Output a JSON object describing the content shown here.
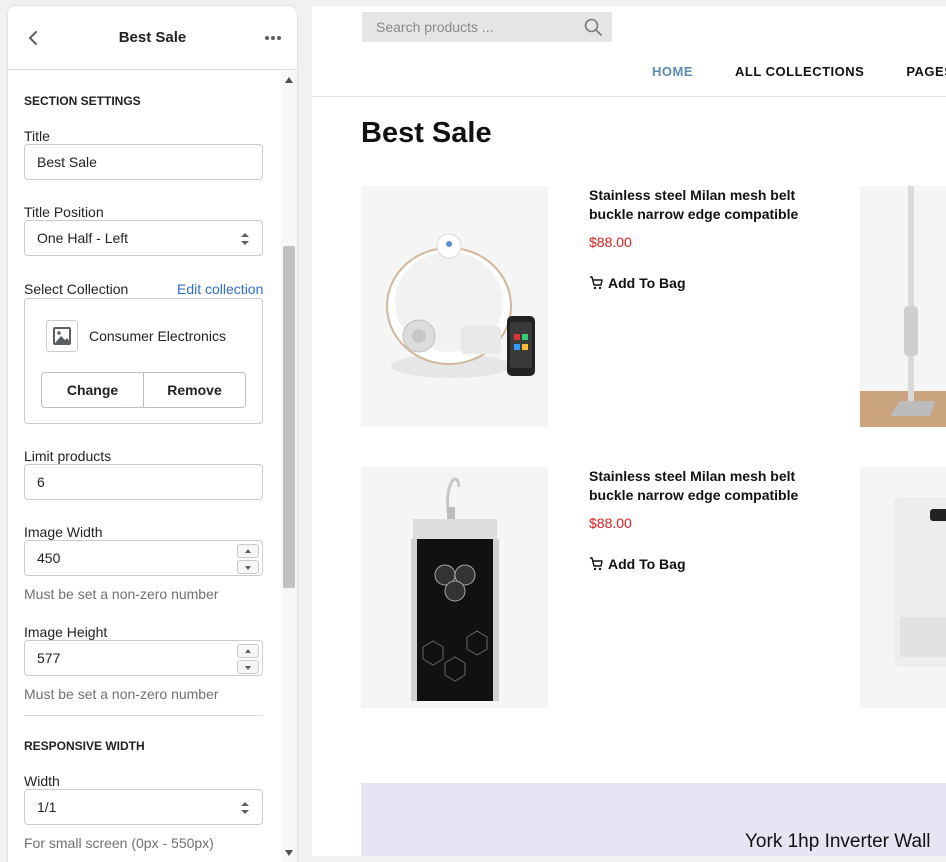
{
  "panel": {
    "title": "Best Sale",
    "section_settings_heading": "SECTION SETTINGS",
    "title_label": "Title",
    "title_value": "Best Sale",
    "title_position_label": "Title Position",
    "title_position_value": "One Half - Left",
    "select_collection_label": "Select Collection",
    "edit_collection_link": "Edit collection",
    "collection_name": "Consumer Electronics",
    "change_button": "Change",
    "remove_button": "Remove",
    "limit_label": "Limit products",
    "limit_value": "6",
    "image_width_label": "Image Width",
    "image_width_value": "450",
    "image_width_help": "Must be set a non-zero number",
    "image_height_label": "Image Height",
    "image_height_value": "577",
    "image_height_help": "Must be set a non-zero number",
    "responsive_heading": "RESPONSIVE WIDTH",
    "width_label": "Width",
    "width_value": "1/1",
    "width_help": "For small screen (0px - 550px)"
  },
  "preview": {
    "search_placeholder": "Search products ...",
    "nav": [
      "HOME",
      "ALL COLLECTIONS",
      "PAGES"
    ],
    "section_title": "Best Sale",
    "products": [
      {
        "name": "Stainless steel Milan mesh belt buckle narrow edge compatible",
        "price": "$88.00",
        "cta": "Add To Bag"
      },
      {
        "name": "Stainless steel Milan mesh belt buckle narrow edge compatible",
        "price": "$88.00",
        "cta": "Add To Bag"
      }
    ],
    "promo_text": "York 1hp Inverter Wall"
  },
  "colors": {
    "link": "#2c6ecb",
    "nav_active": "#5b8bb8",
    "price": "#e01b1b",
    "promo_bg": "#e6e5f4"
  }
}
